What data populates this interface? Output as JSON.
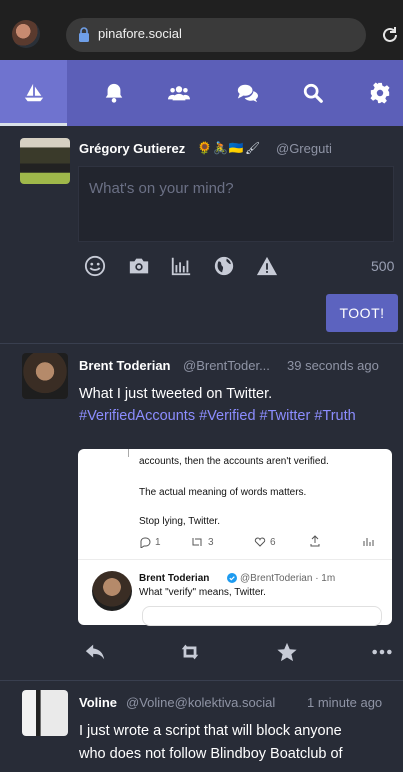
{
  "browser": {
    "url": "pinafore.social"
  },
  "nav": {
    "tabs": [
      {
        "name": "home",
        "icon": "sailboat-icon"
      },
      {
        "name": "notifications",
        "icon": "bell-icon"
      },
      {
        "name": "local",
        "icon": "users-icon"
      },
      {
        "name": "federated",
        "icon": "comments-icon"
      },
      {
        "name": "search",
        "icon": "search-icon"
      },
      {
        "name": "settings",
        "icon": "gear-icon"
      }
    ]
  },
  "compose": {
    "display_name": "Grégory Gutierez",
    "emoji": "🌻🚴🇺🇦🖌",
    "handle": "@Greguti",
    "placeholder": "What's on your mind?",
    "char_count": "500",
    "toot_label": "TOOT!"
  },
  "statuses": [
    {
      "display_name": "Brent Toderian",
      "handle": "@BrentToder...",
      "time": "39 seconds ago",
      "text": "What I just tweeted on Twitter.",
      "hashtags": "#VerifiedAccounts #Verified #Twitter #Truth",
      "card": {
        "line1": "accounts, then the accounts aren't verified.",
        "line2": "The actual meaning of words matters.",
        "line3": "Stop lying, Twitter.",
        "reply_count": "1",
        "retweet_count": "3",
        "like_count": "6",
        "quote_name": "Brent Toderian",
        "quote_handle": "@BrentToderian · 1m",
        "quote_text": "What \"verify\" means, Twitter."
      }
    },
    {
      "display_name": "Voline",
      "handle": "@Voline@kolektiva.social",
      "time": "1 minute ago",
      "text_line1": "I just wrote a script that will block anyone",
      "text_line2": "who does not follow Blindboy Boatclub of"
    }
  ]
}
